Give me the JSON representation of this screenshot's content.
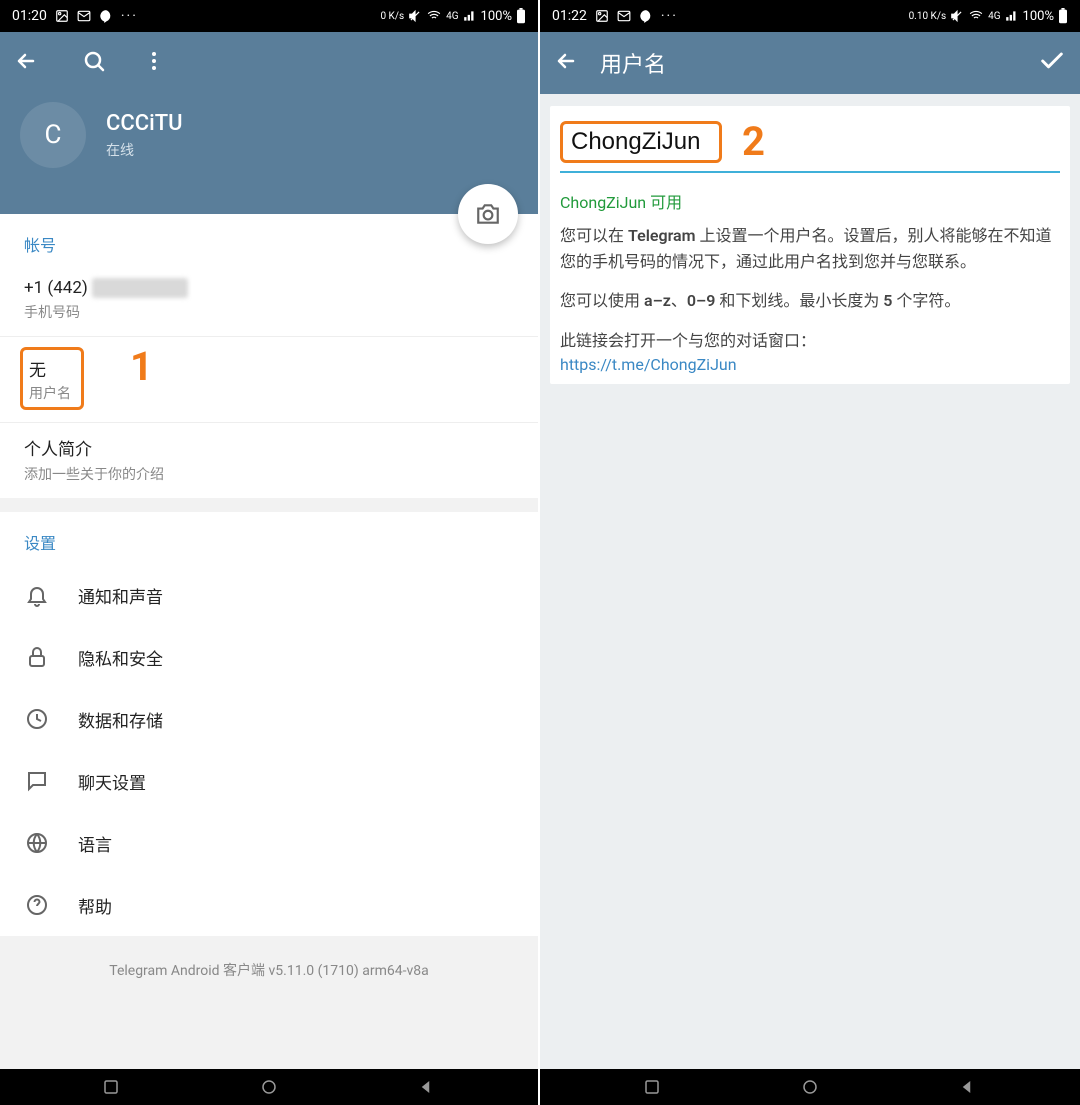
{
  "left": {
    "status": {
      "time": "01:20",
      "net": "0 K/s",
      "battery": "100%"
    },
    "profile": {
      "initial": "C",
      "name": "CCCiTU",
      "status": "在线"
    },
    "account": {
      "header": "帐号",
      "phone_value": "+1 (442)",
      "phone_label": "手机号码",
      "username_value": "无",
      "username_label": "用户名",
      "bio_value": "个人简介",
      "bio_label": "添加一些关于你的介绍"
    },
    "settings": {
      "header": "设置",
      "items": [
        {
          "icon": "bell",
          "label": "通知和声音"
        },
        {
          "icon": "lock",
          "label": "隐私和安全"
        },
        {
          "icon": "clock",
          "label": "数据和存储"
        },
        {
          "icon": "chat",
          "label": "聊天设置"
        },
        {
          "icon": "globe",
          "label": "语言"
        },
        {
          "icon": "help",
          "label": "帮助"
        }
      ]
    },
    "footer": "Telegram Android 客户端 v5.11.0 (1710) arm64-v8a",
    "annot": "1"
  },
  "right": {
    "status": {
      "time": "01:22",
      "net": "0.10 K/s",
      "battery": "100%"
    },
    "title": "用户名",
    "username_value": "ChongZiJun",
    "available_text": "ChongZiJun 可用",
    "desc1_a": "您可以在 ",
    "desc1_b": "Telegram",
    "desc1_c": " 上设置一个用户名。设置后，别人将能够在不知道您的手机号码的情况下，通过此用户名找到您并与您联系。",
    "desc2_a": "您可以使用 ",
    "desc2_b": "a–z",
    "desc2_c": "、",
    "desc2_d": "0–9",
    "desc2_e": " 和下划线。最小长度为 ",
    "desc2_f": "5",
    "desc2_g": " 个字符。",
    "desc3": "此链接会打开一个与您的对话窗口：",
    "link": "https://t.me/ChongZiJun",
    "annot": "2"
  }
}
